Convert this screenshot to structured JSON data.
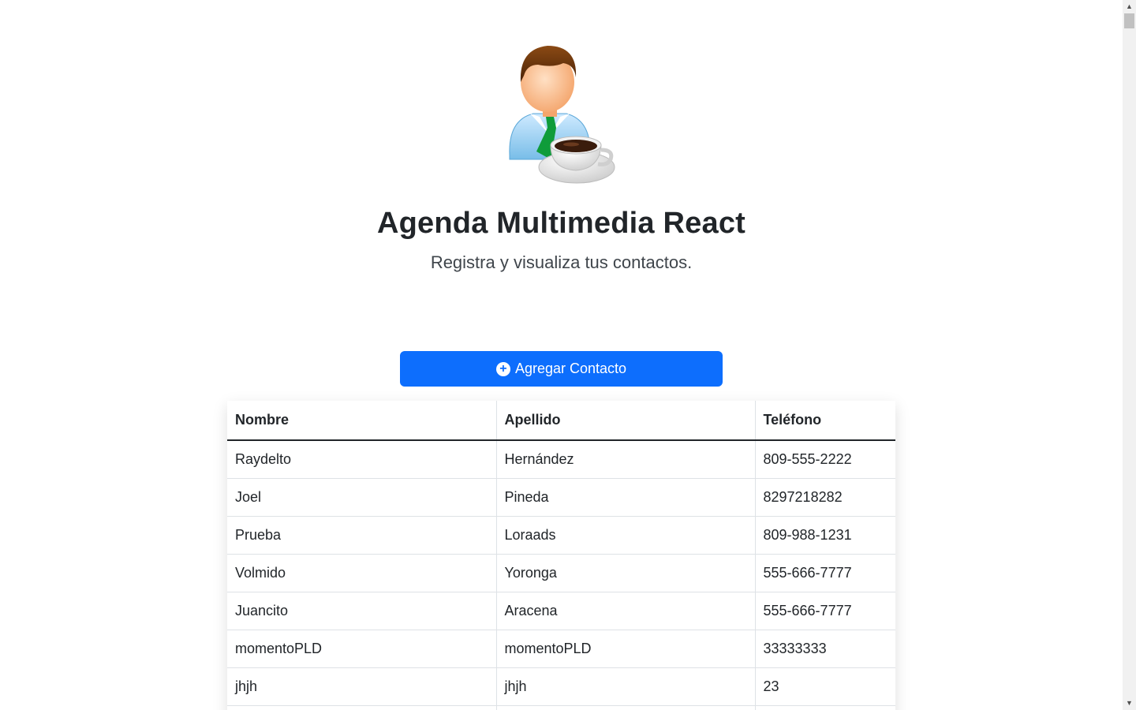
{
  "header": {
    "title": "Agenda Multimedia React",
    "subtitle": "Registra y visualiza tus contactos.",
    "illustration": "businessman-with-coffee-icon"
  },
  "actions": {
    "add_contact_label": "Agregar Contacto",
    "add_icon": "plus-circle-icon"
  },
  "table": {
    "headers": [
      "Nombre",
      "Apellido",
      "Teléfono"
    ],
    "rows": [
      [
        "Raydelto",
        "Hernández",
        "809-555-2222"
      ],
      [
        "Joel",
        "Pineda",
        "8297218282"
      ],
      [
        "Prueba",
        "Loraads",
        "809-988-1231"
      ],
      [
        "Volmido",
        "Yoronga",
        "555-666-7777"
      ],
      [
        "Juancito",
        "Aracena",
        "555-666-7777"
      ],
      [
        "momentoPLD",
        "momentoPLD",
        "33333333"
      ],
      [
        "jhjh",
        "jhjh",
        "23"
      ],
      [
        "",
        "",
        ""
      ]
    ]
  },
  "colors": {
    "primary": "#0d6efd",
    "text": "#212529",
    "border": "#dee2e6"
  }
}
